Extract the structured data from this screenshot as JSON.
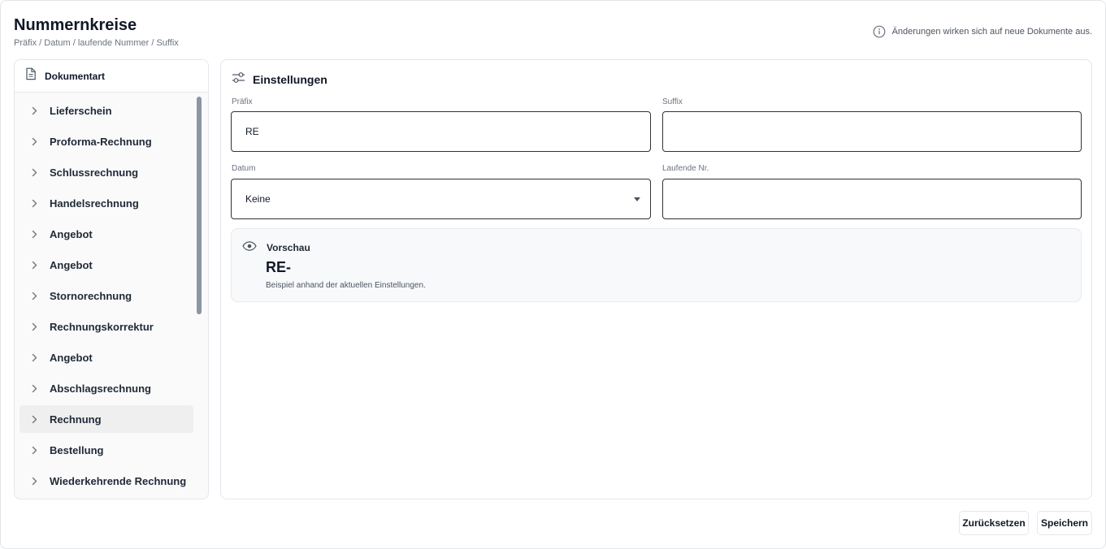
{
  "header": {
    "title": "Nummernkreise",
    "subtitle": "Präfix / Datum / laufende Nummer / Suffix",
    "info_text": "Änderungen wirken sich auf neue Dokumente aus."
  },
  "sidebar": {
    "title": "Dokumentart",
    "items": [
      {
        "label": "Lieferschein"
      },
      {
        "label": "Proforma-Rechnung"
      },
      {
        "label": "Schlussrechnung"
      },
      {
        "label": "Handelsrechnung"
      },
      {
        "label": "Angebot"
      },
      {
        "label": "Angebot"
      },
      {
        "label": "Stornorechnung"
      },
      {
        "label": "Rechnungskorrektur"
      },
      {
        "label": "Angebot"
      },
      {
        "label": "Abschlagsrechnung"
      },
      {
        "label": "Rechnung"
      },
      {
        "label": "Bestellung"
      },
      {
        "label": "Wiederkehrende Rechnung"
      }
    ],
    "active_item": "Rechnung"
  },
  "settings": {
    "title": "Einstellungen",
    "prefix": {
      "label": "Präfix",
      "value": "RE"
    },
    "suffix": {
      "label": "Suffix",
      "value": ""
    },
    "date": {
      "label": "Datum",
      "value": "Keine"
    },
    "running_number": {
      "label": "Laufende Nr.",
      "value": ""
    }
  },
  "preview": {
    "title": "Vorschau",
    "value": "RE-",
    "hint": "Beispiel anhand der aktuellen Einstellungen."
  },
  "actions": {
    "reset_label": "Zurücksetzen",
    "save_label": "Speichern"
  },
  "colors": {
    "border": "#e5e7eb",
    "field_border": "#2f3237",
    "active_row": "#efefef",
    "scrollbar": "#8b95a3",
    "preview_bg": "#f8f9fa"
  }
}
